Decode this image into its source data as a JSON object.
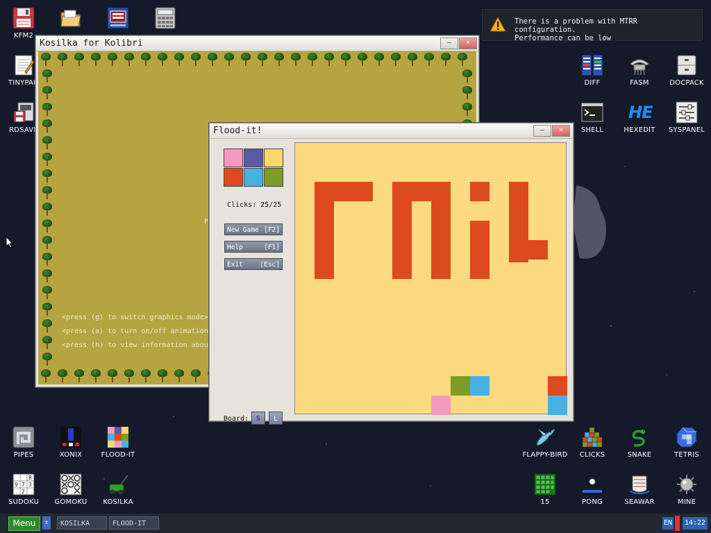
{
  "desktop": {
    "left_icons": [
      {
        "label": "KFM2",
        "icon": "floppy-icon"
      },
      {
        "label": "",
        "icon": "folder-icon"
      },
      {
        "label": "",
        "icon": "display-settings-icon"
      },
      {
        "label": "",
        "icon": "calculator-icon"
      },
      {
        "label": "TINYPAD",
        "icon": "notepad-icon"
      },
      {
        "label": "RDSAVE",
        "icon": "ramdisk-save-icon"
      }
    ],
    "right_icons": [
      {
        "label": "DIFF",
        "icon": "diff-icon"
      },
      {
        "label": "FASM",
        "icon": "fasm-icon"
      },
      {
        "label": "DOCPACK",
        "icon": "docpack-icon"
      },
      {
        "label": "SHELL",
        "icon": "shell-icon"
      },
      {
        "label": "HEXEDIT",
        "icon": "hexedit-icon",
        "glyph": "HE"
      },
      {
        "label": "SYSPANEL",
        "icon": "syspanel-icon"
      }
    ],
    "bottom_left_icons": [
      {
        "label": "PIPES",
        "icon": "pipes-icon"
      },
      {
        "label": "XONIX",
        "icon": "xonix-icon"
      },
      {
        "label": "FLOOD-IT",
        "icon": "flood-it-icon"
      },
      {
        "label": "SUDOKU",
        "icon": "sudoku-icon"
      },
      {
        "label": "GOMOKU",
        "icon": "gomoku-icon"
      },
      {
        "label": "KOSILKA",
        "icon": "lawnmower-icon"
      }
    ],
    "bottom_right_icons": [
      {
        "label": "FLAPPY-BIRD",
        "icon": "bird-icon"
      },
      {
        "label": "CLICKS",
        "icon": "clicks-icon"
      },
      {
        "label": "SNAKE",
        "icon": "snake-icon"
      },
      {
        "label": "TETRIS",
        "icon": "tetris-icon"
      },
      {
        "label": "15",
        "icon": "fifteen-icon"
      },
      {
        "label": "PONG",
        "icon": "pong-icon"
      },
      {
        "label": "SEAWAR",
        "icon": "seawar-icon"
      },
      {
        "label": "MINE",
        "icon": "mine-icon"
      }
    ]
  },
  "notification": {
    "line1": "There is a problem with MTRR configuration.",
    "line2": "Performance can be low",
    "icon": "warning-icon"
  },
  "kosilka": {
    "title": "Kosilka for Kolibri",
    "partial_char": "P",
    "hints": [
      "<press (g) to switch graphics mode>",
      "<press (a) to turn on/off animation>",
      "<press (h) to view information about"
    ],
    "colors": {
      "grass": "#b6a441",
      "text": "#f0e9c6"
    }
  },
  "floodit": {
    "title": "Flood-it!",
    "palette": [
      "#f49ac0",
      "#5b5aa5",
      "#fbd76c",
      "#dc4a1d",
      "#46b1e2",
      "#7e9c23"
    ],
    "clicks_text": "Clicks: 25/25",
    "buttons": [
      {
        "label": "New Game",
        "key": "[F2]"
      },
      {
        "label": "Help",
        "key": "[F1]"
      },
      {
        "label": "Exit",
        "key": "[Esc]"
      }
    ],
    "board_label": "Board:",
    "size_small": "S",
    "size_large": "L",
    "board_background": "#fcda7f",
    "message_color": "#dc4a1d",
    "message_text": "FAIL",
    "remaining_cells": [
      {
        "col": 8,
        "row": 12,
        "color": "#7e9c23"
      },
      {
        "col": 9,
        "row": 12,
        "color": "#46b1e2"
      },
      {
        "col": 13,
        "row": 12,
        "color": "#dc4a1d"
      },
      {
        "col": 7,
        "row": 13,
        "color": "#f49ac0"
      },
      {
        "col": 13,
        "row": 13,
        "color": "#46b1e2"
      }
    ]
  },
  "window_buttons": {
    "minimize": "—",
    "close": "✕"
  },
  "taskbar": {
    "menu": "Menu",
    "switch_glyph": "⇕",
    "tasks": [
      "KOSILKA",
      "FLOOD-IT"
    ],
    "lang": "EN",
    "clock": "14:22"
  }
}
